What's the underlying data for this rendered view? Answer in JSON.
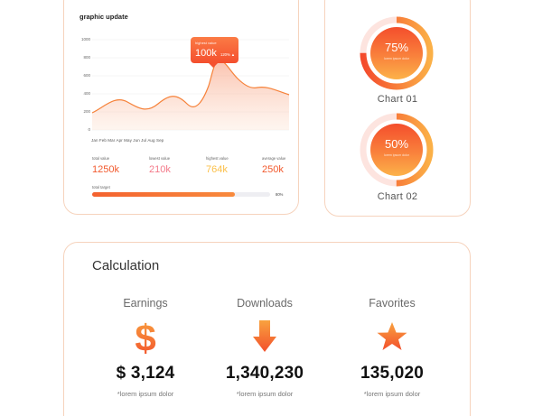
{
  "graph": {
    "title": "graphic update",
    "y_ticks": [
      "1000",
      "800",
      "600",
      "400",
      "200",
      "0"
    ],
    "x_labels": "Jan Feb Mar Apr May Jun Jul Aug Sep",
    "tooltip": {
      "label": "highest value",
      "value": "100k",
      "percent": "120% ▲"
    },
    "stats": [
      {
        "label": "total value",
        "value": "1250k",
        "color": "#f25a2e"
      },
      {
        "label": "lowest value",
        "value": "210k",
        "color": "#f47a8a"
      },
      {
        "label": "highest value",
        "value": "764k",
        "color": "#fbc04a"
      },
      {
        "label": "average value",
        "value": "250k",
        "color": "#f25a2e"
      }
    ],
    "total_target": {
      "label": "total target",
      "percent": "80%",
      "progress": 0.8
    },
    "accent": "#f6823a"
  },
  "charts": [
    {
      "percent": "75%",
      "sub": "lorem ipsum dolor",
      "label": "Chart 01",
      "progress": 0.75
    },
    {
      "percent": "50%",
      "sub": "lorem ipsum dolor",
      "label": "Chart 02",
      "progress": 0.5
    }
  ],
  "calculation": {
    "title": "Calculation",
    "items": [
      {
        "label": "Earnings",
        "icon": "dollar-icon",
        "value": "$ 3,124",
        "note": "*lorem ipsum dolor"
      },
      {
        "label": "Downloads",
        "icon": "arrow-down-icon",
        "value": "1,340,230",
        "note": "*lorem ipsum dolor"
      },
      {
        "label": "Favorites",
        "icon": "star-icon",
        "value": "135,020",
        "note": "*lorem ipsum dolor"
      }
    ]
  }
}
